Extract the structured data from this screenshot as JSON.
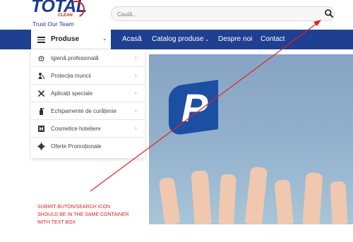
{
  "brand": {
    "logo_text": "TOTAL",
    "logo_sub": "CLEAN",
    "tagline": "Trust Our Team"
  },
  "search": {
    "placeholder": "Caută..."
  },
  "nav": {
    "produse_label": "Produse",
    "items": [
      {
        "label": "Acasă"
      },
      {
        "label": "Catalog produse"
      },
      {
        "label": "Despre noi"
      },
      {
        "label": "Contact"
      }
    ]
  },
  "menu": {
    "items": [
      {
        "label": "Igienă profesională",
        "icon": "hygiene-icon"
      },
      {
        "label": "Protecția muncii",
        "icon": "worker-icon"
      },
      {
        "label": "Aplicații speciale",
        "icon": "tools-icon"
      },
      {
        "label": "Echipamente de curățenie",
        "icon": "spray-bottle-icon"
      },
      {
        "label": "Cosmetice hoteliere",
        "icon": "hotel-icon"
      },
      {
        "label": "Oferte Promoționale",
        "icon": "gear-icon"
      }
    ]
  },
  "annotation": {
    "lines": [
      "SUBMIT BUTON/SEARCH ICON",
      "SHOULD BE IN THE SAME CONTAINER",
      "WITH TEXT BOX"
    ],
    "color": "#e82020"
  },
  "colors": {
    "navbar": "#1f3f91",
    "accent": "#e02020",
    "brand": "#1a3a8c"
  }
}
